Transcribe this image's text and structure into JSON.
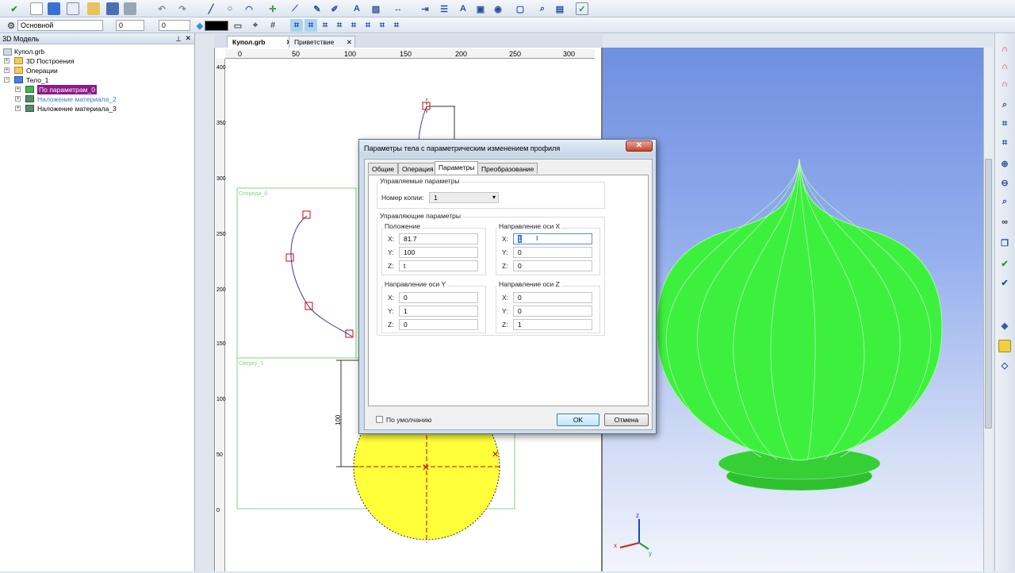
{
  "toolbar": {
    "style_value": "Основной",
    "num1": "0",
    "num2": "0"
  },
  "tree": {
    "header": "3D Модель",
    "items": [
      {
        "label": "Купол.grb"
      },
      {
        "label": "3D Построения"
      },
      {
        "label": "Операции"
      },
      {
        "label": "Тело_1"
      },
      {
        "label": "По параметрам_0"
      },
      {
        "label": "Наложение материала_2"
      },
      {
        "label": "Наложение материала_3"
      }
    ]
  },
  "doc_tabs": [
    {
      "label": "Купол.grb"
    },
    {
      "label": "Приветствие"
    }
  ],
  "ruler": {
    "top": [
      "0",
      "50",
      "100",
      "150",
      "200",
      "250",
      "300"
    ],
    "left": [
      "400",
      "350",
      "300",
      "250",
      "200",
      "150",
      "100",
      "50",
      "0"
    ]
  },
  "drawing": {
    "label_front": "Спереди_0",
    "label_top": "Сверху_1",
    "dimension": "100"
  },
  "dialog": {
    "title": "Параметры тела с параметрическим изменением профиля",
    "close": "✕",
    "tabs": [
      "Общие",
      "Операция",
      "Параметры",
      "Преобразование"
    ],
    "managed_group": "Управляемые параметры",
    "copy_number_label": "Номер копии:",
    "copy_number_value": "1",
    "control_group": "Управляющие параметры",
    "position": {
      "title": "Положение",
      "x_label": "X:",
      "x": "81.7",
      "y_label": "Y:",
      "y": "100",
      "z_label": "Z:",
      "z": "t"
    },
    "axis_x": {
      "title": "Направление оси X",
      "x_label": "X:",
      "x": "1",
      "y_label": "Y:",
      "y": "0",
      "z_label": "Z:",
      "z": "0"
    },
    "axis_y": {
      "title": "Направление оси Y",
      "x_label": "X:",
      "x": "0",
      "y_label": "Y:",
      "y": "1",
      "z_label": "Z:",
      "z": "0"
    },
    "axis_z": {
      "title": "Направление оси Z",
      "x_label": "X:",
      "x": "0",
      "y_label": "Y:",
      "y": "0",
      "z_label": "Z:",
      "z": "1"
    },
    "default_label": "По умолчанию",
    "ok": "OK",
    "cancel": "Отмена"
  },
  "axes3d": {
    "x": "x",
    "y": "y",
    "z": "z"
  },
  "colors": {
    "dome": "#3ef03e",
    "selection": "#8b1a8b",
    "view_top": "#6f8fe0"
  }
}
